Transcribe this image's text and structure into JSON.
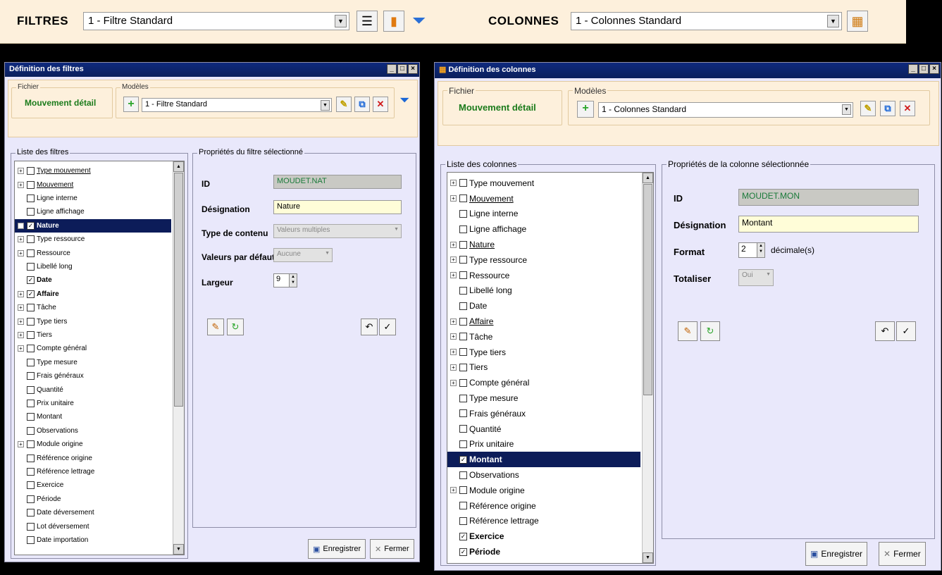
{
  "topbar": {
    "filtres_label": "FILTRES",
    "filtres_value": "1 - Filtre Standard",
    "colonnes_label": "COLONNES",
    "colonnes_value": "1 - Colonnes Standard"
  },
  "filters_window": {
    "title": "Définition des filtres",
    "fichier_label": "Fichier",
    "fichier_value": "Mouvement détail",
    "modeles_label": "Modèles",
    "modele_value": "1 - Filtre Standard",
    "list_label": "Liste des filtres",
    "props_label": "Propriétés du filtre sélectionné",
    "items": [
      {
        "label": "Type mouvement",
        "exp": true,
        "checked": false,
        "u": true,
        "b": false,
        "sel": false
      },
      {
        "label": "Mouvement",
        "exp": true,
        "checked": false,
        "u": true,
        "b": false,
        "sel": false
      },
      {
        "label": "Ligne interne",
        "exp": false,
        "checked": false,
        "u": false,
        "b": false,
        "sel": false
      },
      {
        "label": "Ligne affichage",
        "exp": false,
        "checked": false,
        "u": false,
        "b": false,
        "sel": false
      },
      {
        "label": "Nature",
        "exp": true,
        "checked": true,
        "u": false,
        "b": true,
        "sel": true
      },
      {
        "label": "Type ressource",
        "exp": true,
        "checked": false,
        "u": false,
        "b": false,
        "sel": false
      },
      {
        "label": "Ressource",
        "exp": true,
        "checked": false,
        "u": false,
        "b": false,
        "sel": false
      },
      {
        "label": "Libellé long",
        "exp": false,
        "checked": false,
        "u": false,
        "b": false,
        "sel": false
      },
      {
        "label": "Date",
        "exp": false,
        "checked": true,
        "u": false,
        "b": true,
        "sel": false
      },
      {
        "label": "Affaire",
        "exp": true,
        "checked": true,
        "u": false,
        "b": true,
        "sel": false
      },
      {
        "label": "Tâche",
        "exp": true,
        "checked": false,
        "u": false,
        "b": false,
        "sel": false
      },
      {
        "label": "Type tiers",
        "exp": true,
        "checked": false,
        "u": false,
        "b": false,
        "sel": false
      },
      {
        "label": "Tiers",
        "exp": true,
        "checked": false,
        "u": false,
        "b": false,
        "sel": false
      },
      {
        "label": "Compte général",
        "exp": true,
        "checked": false,
        "u": false,
        "b": false,
        "sel": false
      },
      {
        "label": "Type mesure",
        "exp": false,
        "checked": false,
        "u": false,
        "b": false,
        "sel": false
      },
      {
        "label": "Frais généraux",
        "exp": false,
        "checked": false,
        "u": false,
        "b": false,
        "sel": false
      },
      {
        "label": "Quantité",
        "exp": false,
        "checked": false,
        "u": false,
        "b": false,
        "sel": false
      },
      {
        "label": "Prix unitaire",
        "exp": false,
        "checked": false,
        "u": false,
        "b": false,
        "sel": false
      },
      {
        "label": "Montant",
        "exp": false,
        "checked": false,
        "u": false,
        "b": false,
        "sel": false
      },
      {
        "label": "Observations",
        "exp": false,
        "checked": false,
        "u": false,
        "b": false,
        "sel": false
      },
      {
        "label": "Module origine",
        "exp": true,
        "checked": false,
        "u": false,
        "b": false,
        "sel": false
      },
      {
        "label": "Référence origine",
        "exp": false,
        "checked": false,
        "u": false,
        "b": false,
        "sel": false
      },
      {
        "label": "Référence lettrage",
        "exp": false,
        "checked": false,
        "u": false,
        "b": false,
        "sel": false
      },
      {
        "label": "Exercice",
        "exp": false,
        "checked": false,
        "u": false,
        "b": false,
        "sel": false
      },
      {
        "label": "Période",
        "exp": false,
        "checked": false,
        "u": false,
        "b": false,
        "sel": false
      },
      {
        "label": "Date déversement",
        "exp": false,
        "checked": false,
        "u": false,
        "b": false,
        "sel": false
      },
      {
        "label": "Lot déversement",
        "exp": false,
        "checked": false,
        "u": false,
        "b": false,
        "sel": false
      },
      {
        "label": "Date importation",
        "exp": false,
        "checked": false,
        "u": false,
        "b": false,
        "sel": false
      }
    ],
    "props": {
      "id_label": "ID",
      "id_value": "MOUDET.NAT",
      "designation_label": "Désignation",
      "designation_value": "Nature",
      "contenu_label": "Type de contenu",
      "contenu_value": "Valeurs multiples",
      "defaut_label": "Valeurs par défaut",
      "defaut_value": "Aucune",
      "largeur_label": "Largeur",
      "largeur_value": "9"
    },
    "enregistrer": "Enregistrer",
    "fermer": "Fermer"
  },
  "columns_window": {
    "title": "Définition des colonnes",
    "fichier_label": "Fichier",
    "fichier_value": "Mouvement détail",
    "modeles_label": "Modèles",
    "modele_value": "1 - Colonnes Standard",
    "list_label": "Liste des colonnes",
    "props_label": "Propriétés de la colonne sélectionnée",
    "items": [
      {
        "label": "Type mouvement",
        "exp": true,
        "checked": false,
        "u": false,
        "b": false,
        "sel": false
      },
      {
        "label": "Mouvement",
        "exp": true,
        "checked": false,
        "u": true,
        "b": false,
        "sel": false
      },
      {
        "label": "Ligne interne",
        "exp": false,
        "checked": false,
        "u": false,
        "b": false,
        "sel": false
      },
      {
        "label": "Ligne affichage",
        "exp": false,
        "checked": false,
        "u": false,
        "b": false,
        "sel": false
      },
      {
        "label": "Nature",
        "exp": true,
        "checked": false,
        "u": true,
        "b": false,
        "sel": false
      },
      {
        "label": "Type ressource",
        "exp": true,
        "checked": false,
        "u": false,
        "b": false,
        "sel": false
      },
      {
        "label": "Ressource",
        "exp": true,
        "checked": false,
        "u": false,
        "b": false,
        "sel": false
      },
      {
        "label": "Libellé long",
        "exp": false,
        "checked": false,
        "u": false,
        "b": false,
        "sel": false
      },
      {
        "label": "Date",
        "exp": false,
        "checked": false,
        "u": false,
        "b": false,
        "sel": false
      },
      {
        "label": "Affaire",
        "exp": true,
        "checked": false,
        "u": true,
        "b": false,
        "sel": false
      },
      {
        "label": "Tâche",
        "exp": true,
        "checked": false,
        "u": false,
        "b": false,
        "sel": false
      },
      {
        "label": "Type tiers",
        "exp": true,
        "checked": false,
        "u": false,
        "b": false,
        "sel": false
      },
      {
        "label": "Tiers",
        "exp": true,
        "checked": false,
        "u": false,
        "b": false,
        "sel": false
      },
      {
        "label": "Compte général",
        "exp": true,
        "checked": false,
        "u": false,
        "b": false,
        "sel": false
      },
      {
        "label": "Type mesure",
        "exp": false,
        "checked": false,
        "u": false,
        "b": false,
        "sel": false
      },
      {
        "label": "Frais généraux",
        "exp": false,
        "checked": false,
        "u": false,
        "b": false,
        "sel": false
      },
      {
        "label": "Quantité",
        "exp": false,
        "checked": false,
        "u": false,
        "b": false,
        "sel": false
      },
      {
        "label": "Prix unitaire",
        "exp": false,
        "checked": false,
        "u": false,
        "b": false,
        "sel": false
      },
      {
        "label": "Montant",
        "exp": false,
        "checked": true,
        "u": false,
        "b": true,
        "sel": true
      },
      {
        "label": "Observations",
        "exp": false,
        "checked": false,
        "u": false,
        "b": false,
        "sel": false
      },
      {
        "label": "Module origine",
        "exp": true,
        "checked": false,
        "u": false,
        "b": false,
        "sel": false
      },
      {
        "label": "Référence origine",
        "exp": false,
        "checked": false,
        "u": false,
        "b": false,
        "sel": false
      },
      {
        "label": "Référence lettrage",
        "exp": false,
        "checked": false,
        "u": false,
        "b": false,
        "sel": false
      },
      {
        "label": "Exercice",
        "exp": false,
        "checked": true,
        "u": false,
        "b": true,
        "sel": false
      },
      {
        "label": "Période",
        "exp": false,
        "checked": true,
        "u": false,
        "b": true,
        "sel": false
      }
    ],
    "props": {
      "id_label": "ID",
      "id_value": "MOUDET.MON",
      "designation_label": "Désignation",
      "designation_value": "Montant",
      "format_label": "Format",
      "format_value": "2",
      "format_suffix": "décimale(s)",
      "totaliser_label": "Totaliser",
      "totaliser_value": "Oui"
    },
    "enregistrer": "Enregistrer",
    "fermer": "Fermer"
  }
}
